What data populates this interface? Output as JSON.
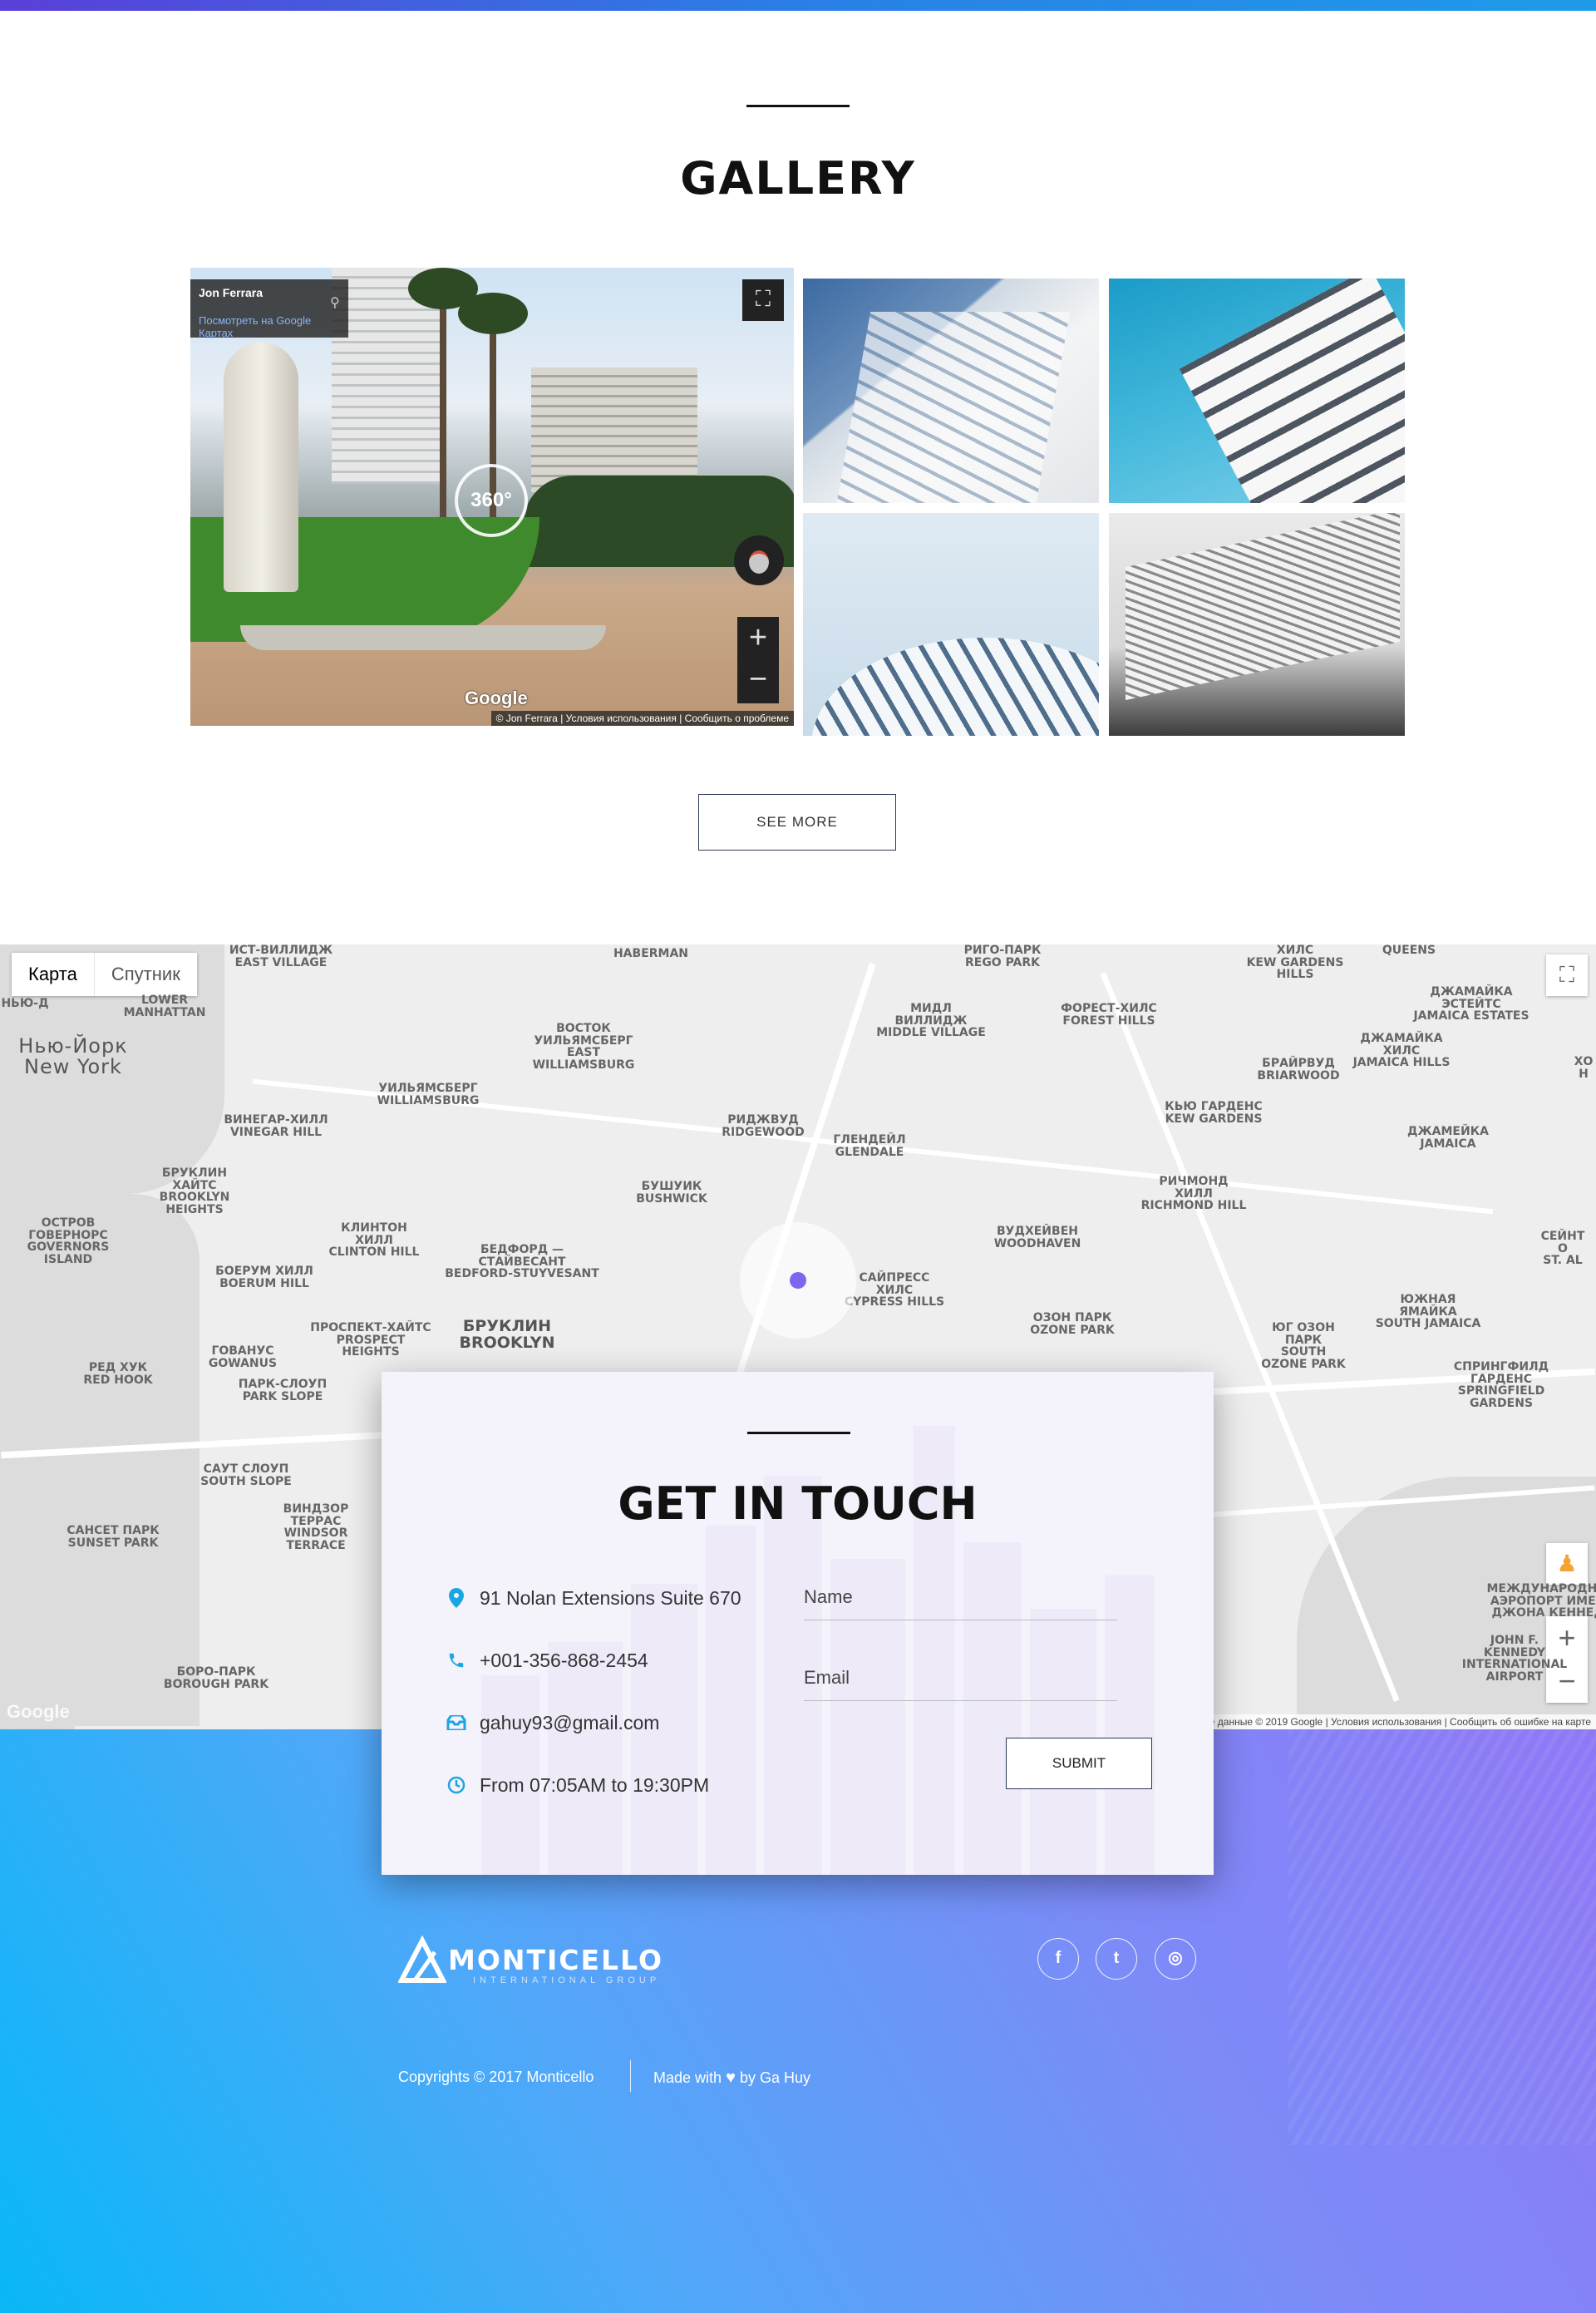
{
  "gallery": {
    "title": "GALLERY",
    "see_more_label": "SEE MORE",
    "panorama": {
      "author": "Jon Ferrara",
      "view_link": "Посмотреть на Google Картах",
      "badge_360": "360°",
      "google_logo": "Google",
      "bottom_credit": "© Jon Ferrara",
      "bottom_terms": "Условия использования",
      "bottom_report": "Сообщить о проблеме",
      "zoom_in": "+",
      "zoom_out": "−"
    },
    "images": [
      "building-facade-1",
      "building-facade-2",
      "building-curve-3",
      "building-broad-4"
    ]
  },
  "map": {
    "type_map": "Карта",
    "type_satellite": "Спутник",
    "zoom_in": "+",
    "zoom_out": "−",
    "google_logo": "Google",
    "bottom_data": "Картографические данные © 2019 Google",
    "bottom_terms": "Условия использования",
    "bottom_report": "Сообщить об ошибке на карте",
    "labels": [
      {
        "t": "Нью-Йорк\nNew York",
        "cls": "big"
      },
      {
        "t": "ИСТ-ВИЛЛИДЖ\nEAST VILLAGE"
      },
      {
        "t": "LOWER\nMANHATTAN"
      },
      {
        "t": "Haberman"
      },
      {
        "t": "РИГО-ПАРК\nREGO PARK"
      },
      {
        "t": "ХИЛС\nKEW GARDENS\nHILLS"
      },
      {
        "t": "QUEENS"
      },
      {
        "t": "ВОСТОК\nУИЛЬЯМСБЕРГ\nEAST\nWILLIAMSBURG"
      },
      {
        "t": "МИДЛ\nВИЛЛИДЖ\nMIDDLE VILLAGE"
      },
      {
        "t": "ФОРЕСТ-ХИЛС\nFOREST HILLS"
      },
      {
        "t": "ДЖАМАЙКА\nЭСТЕЙТС\nJAMAICA ESTATES"
      },
      {
        "t": "ДЖАМАЙКА\nХИЛС\nJAMAICA HILLS"
      },
      {
        "t": "БРАЙРВУД\nBRIARWOOD"
      },
      {
        "t": "УИЛЬЯМСБЕРГ\nWILLIAMSBURG"
      },
      {
        "t": "ВИНЕГАР-ХИЛЛ\nVINEGAR HILL"
      },
      {
        "t": "РИДЖВУД\nRIDGEWOOD"
      },
      {
        "t": "ГЛЕНДЕЙЛ\nGLENDALE"
      },
      {
        "t": "КЬЮ ГАРДЕНС\nKEW GARDENS"
      },
      {
        "t": "ДЖАМЕЙКА\nJAMAICA"
      },
      {
        "t": "БРУКЛИН\nХАЙТС\nBROOKLYN\nHEIGHTS"
      },
      {
        "t": "БУШУИК\nBUSHWICK"
      },
      {
        "t": "РИЧМОНД\nХИЛЛ\nRICHMOND HILL"
      },
      {
        "t": "Остров\nГовернорс\nGovernors\nIsland"
      },
      {
        "t": "КЛИНТОН\nХИЛЛ\nCLINTON HILL"
      },
      {
        "t": "БЕДФОРД —\nСТАЙВЕСАНТ\nBEDFORD-STUYVESANT"
      },
      {
        "t": "ВУДХЕЙВЕН\nWOODHAVEN"
      },
      {
        "t": "СЕЙНТ О\nST. AL"
      },
      {
        "t": "БОЕРУМ ХИЛЛ\nBOERUM HILL"
      },
      {
        "t": "САЙПРЕСС\nХИЛС\nCYPRESS HILLS"
      },
      {
        "t": "ОЗОН ПАРК\nOZONE PARK"
      },
      {
        "t": "ЮЖНАЯ\nЯМАЙКА\nSOUTH JAMAICA"
      },
      {
        "t": "ПРОСПЕКТ-ХАЙТС\nPROSPECT\nHEIGHTS"
      },
      {
        "t": "БРУКЛИН\nBROOKLYN",
        "cls": "mid"
      },
      {
        "t": "ЮГ ОЗОН\nПАРК\nSOUTH\nOZONE PARK"
      },
      {
        "t": "РЕД ХУК\nRED HOOK"
      },
      {
        "t": "ГОВАНУС\nGOWANUS"
      },
      {
        "t": "ПАРК-СЛОУП\nPARK SLOPE"
      },
      {
        "t": "СПРИНГФИЛД\nГАРДЕНС\nSPRINGFIELD\nGARDENS"
      },
      {
        "t": "САУТ СЛОУП\nSOUTH SLOPE"
      },
      {
        "t": "ВИНДЗОР\nТЕРРАС\nWINDSOR\nTERRACE"
      },
      {
        "t": "САНСЕТ ПАРК\nSUNSET PARK"
      },
      {
        "t": "Международный\nаэропорт имени\nДжона Кеннеди"
      },
      {
        "t": "John F.\nKennedy\nInternational\nAirport"
      },
      {
        "t": "БОРО-ПАРК\nBOROUGH PARK"
      },
      {
        "t": "Нью-Д"
      },
      {
        "t": "ХО\nН"
      }
    ]
  },
  "contact": {
    "title": "GET IN TOUCH",
    "address": "91 Nolan Extensions Suite 670",
    "phone": "+001-356-868-2454",
    "email": "gahuy93@gmail.com",
    "hours": "From 07:05AM to 19:30PM",
    "name_placeholder": "Name",
    "email_placeholder": "Email",
    "submit_label": "SUBMIT",
    "icon_color": "#1aa6e0"
  },
  "footer": {
    "brand": "MONTICELLO",
    "brand_sub": "INTERNATIONAL GROUP",
    "social": {
      "facebook": "f",
      "twitter": "t",
      "instagram": "◎"
    },
    "copyright": "Copyrights © 2017 Monticello",
    "made_with_prefix": "Made with",
    "made_with_suffix": "by Ga Huy",
    "heart": "♥",
    "gradient_start": "#09b7f7",
    "gradient_end": "#8f78f6"
  }
}
